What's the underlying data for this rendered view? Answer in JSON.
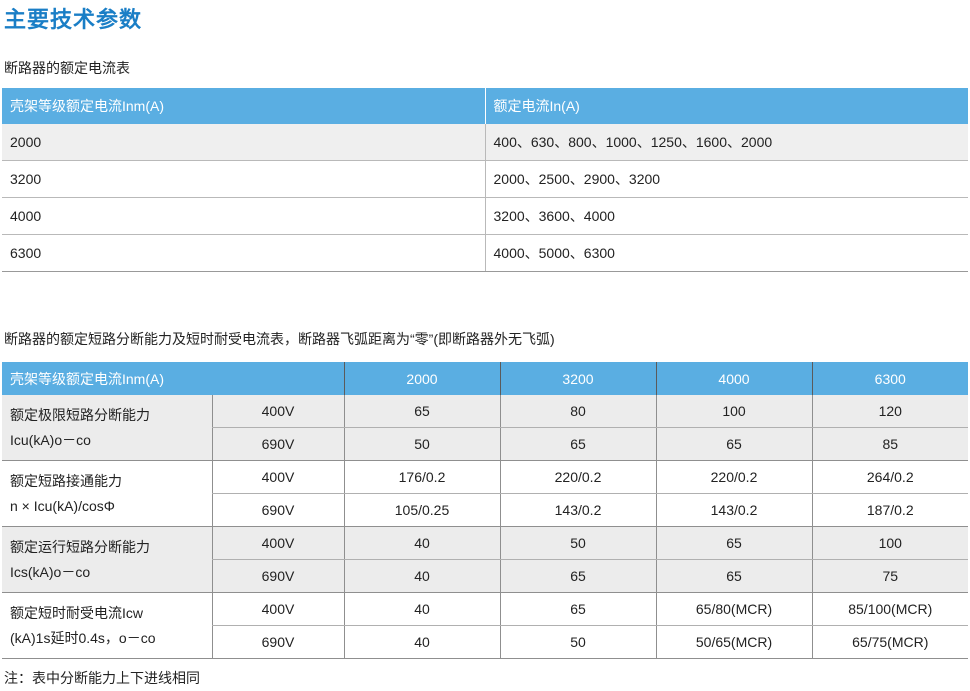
{
  "title": "主要技术参数",
  "table1": {
    "caption": "断路器的额定电流表",
    "headers": [
      "壳架等级额定电流Inm(A)",
      "额定电流In(A)"
    ],
    "rows": [
      [
        "2000",
        "400、630、800、1000、1250、1600、2000"
      ],
      [
        "3200",
        "2000、2500、2900、3200"
      ],
      [
        "4000",
        "3200、3600、4000"
      ],
      [
        "6300",
        "4000、5000、6300"
      ]
    ]
  },
  "table2": {
    "caption": "断路器的额定短路分断能力及短时耐受电流表，断路器飞弧距离为“零”(即断路器外无飞弧)",
    "headers": [
      "壳架等级额定电流Inm(A)",
      "2000",
      "3200",
      "4000",
      "6300"
    ],
    "groups": [
      {
        "name": "额定极限短路分断能力",
        "sub": "Icu(kA)o－co",
        "rows": [
          {
            "voltage": "400V",
            "values": [
              "65",
              "80",
              "100",
              "120"
            ]
          },
          {
            "voltage": "690V",
            "values": [
              "50",
              "65",
              "65",
              "85"
            ]
          }
        ]
      },
      {
        "name": "额定短路接通能力",
        "sub": "n × Icu(kA)/cosΦ",
        "rows": [
          {
            "voltage": "400V",
            "values": [
              "176/0.2",
              "220/0.2",
              "220/0.2",
              "264/0.2"
            ]
          },
          {
            "voltage": "690V",
            "values": [
              "105/0.25",
              "143/0.2",
              "143/0.2",
              "187/0.2"
            ]
          }
        ]
      },
      {
        "name": "额定运行短路分断能力",
        "sub": "Ics(kA)o－co",
        "rows": [
          {
            "voltage": "400V",
            "values": [
              "40",
              "50",
              "65",
              "100"
            ]
          },
          {
            "voltage": "690V",
            "values": [
              "40",
              "65",
              "65",
              "75"
            ]
          }
        ]
      },
      {
        "name": "额定短时耐受电流Icw",
        "sub": "(kA)1s延时0.4s，o－co",
        "rows": [
          {
            "voltage": "400V",
            "values": [
              "40",
              "65",
              "65/80(MCR)",
              "85/100(MCR)"
            ]
          },
          {
            "voltage": "690V",
            "values": [
              "40",
              "50",
              "50/65(MCR)",
              "65/75(MCR)"
            ]
          }
        ]
      }
    ]
  },
  "note": "注：表中分断能力上下进线相同"
}
